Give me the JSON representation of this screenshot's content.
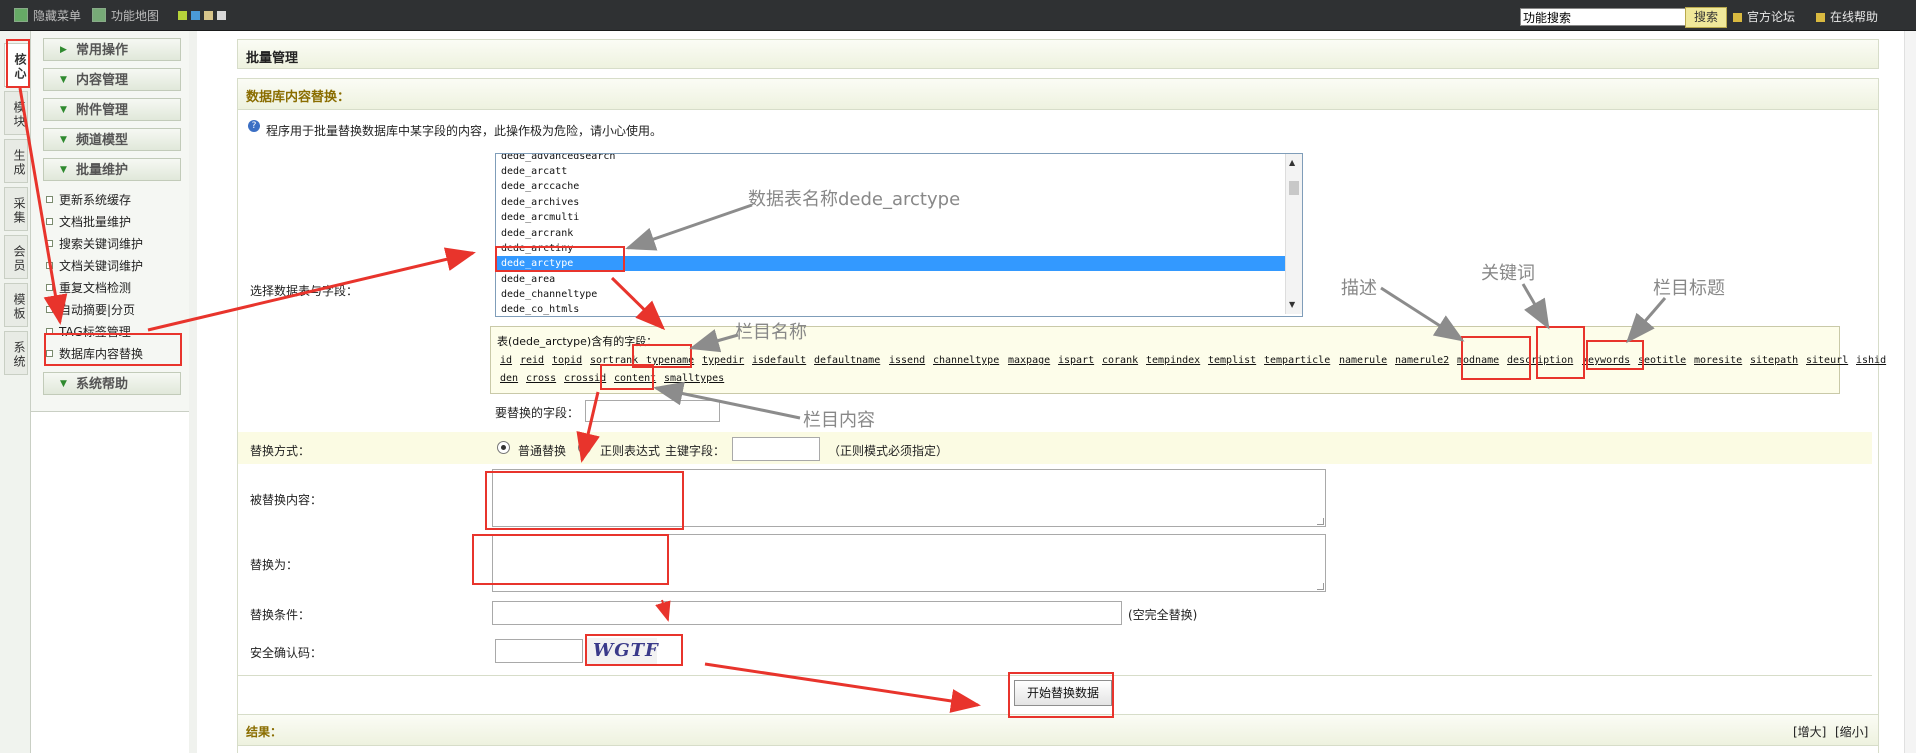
{
  "topbar": {
    "hide_menu": "隐藏菜单",
    "function_map": "功能地图",
    "search_value": "功能搜索",
    "search_button": "搜索",
    "forum": "官方论坛",
    "help": "在线帮助"
  },
  "left_tabs": [
    "核心",
    "模块",
    "生成",
    "采集",
    "会员",
    "模板",
    "系统"
  ],
  "menu": {
    "sections": [
      "常用操作",
      "内容管理",
      "附件管理",
      "频道模型",
      "批量维护",
      "系统帮助"
    ],
    "items": [
      "更新系统缓存",
      "文档批量维护",
      "搜索关键词维护",
      "文档关键词维护",
      "重复文档检测",
      "自动摘要|分页",
      "TAG标签管理",
      "数据库内容替换"
    ]
  },
  "main": {
    "page_title": "批量管理",
    "section_title": "数据库内容替换：",
    "notice": "程序用于批量替换数据库中某字段的内容，此操作极为危险，请小心使用。",
    "select_label": "选择数据表与字段：",
    "tables": [
      "dede_advancedsearch",
      "dede_arcatt",
      "dede_arccache",
      "dede_archives",
      "dede_arcmulti",
      "dede_arcrank",
      "dede_arctiny",
      "dede_arctype",
      "dede_area",
      "dede_channeltype",
      "dede_co_htmls"
    ],
    "selected_table": "dede_arctype",
    "fields_header": "表(dede_arctype)含有的字段：",
    "fields_row1": [
      "id",
      "reid",
      "topid",
      "sortrank",
      "typename",
      "typedir",
      "isdefault",
      "defaultname",
      "issend",
      "channeltype",
      "maxpage",
      "ispart",
      "corank",
      "tempindex",
      "templist",
      "temparticle",
      "namerule",
      "namerule2",
      "modname",
      "description",
      "keywords",
      "seotitle",
      "moresite",
      "sitepath",
      "siteurl",
      "ishid"
    ],
    "fields_row2": [
      "den",
      "cross",
      "crossid",
      "content",
      "smalltypes"
    ],
    "field_to_replace_label": "要替换的字段：",
    "replace_mode_label": "替换方式：",
    "mode_normal": "普通替换",
    "mode_regex": "正则表达式",
    "primary_key_label": "主键字段：",
    "regex_hint": "（正则模式必须指定）",
    "replaced_content_label": "被替换内容：",
    "replace_with_label": "替换为：",
    "condition_label": "替换条件：",
    "condition_hint": "(空完全替换)",
    "captcha_label": "安全确认码：",
    "captcha_text": "WGTF",
    "submit_button": "开始替换数据",
    "result_label": "结果：",
    "enlarge": "[增大]",
    "shrink": "[缩小]"
  },
  "annotations": {
    "table_name": "数据表名称dede_arctype",
    "column_name": "栏目名称",
    "column_content": "栏目内容",
    "description": "描述",
    "keywords": "关键词",
    "column_title": "栏目标题"
  },
  "colors": {
    "annotation_red": "#e8342c",
    "selected_blue": "#3399ff",
    "section_title": "#8a6d00"
  }
}
